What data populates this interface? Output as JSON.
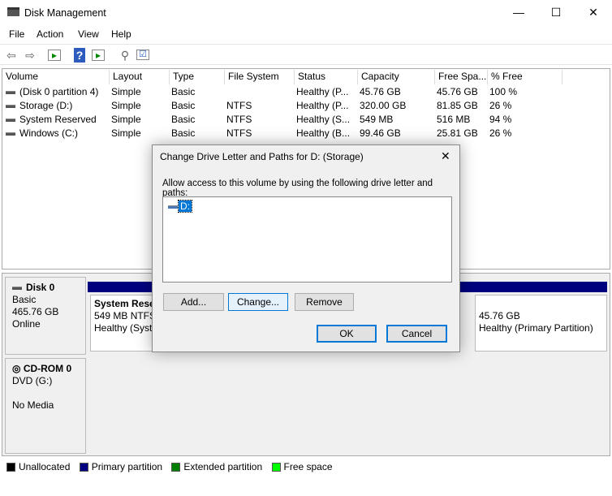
{
  "window": {
    "title": "Disk Management",
    "minimize": "—",
    "maximize": "☐",
    "close": "✕"
  },
  "menu": [
    "File",
    "Action",
    "View",
    "Help"
  ],
  "toolbar": {
    "icons": [
      "back-arrow-icon",
      "forward-arrow-icon",
      "console-tree-icon",
      "help-icon",
      "action-pane-icon",
      "connect-icon",
      "properties-icon"
    ]
  },
  "volume_list": {
    "columns": [
      "Volume",
      "Layout",
      "Type",
      "File System",
      "Status",
      "Capacity",
      "Free Spa...",
      "% Free"
    ],
    "rows": [
      [
        "(Disk 0 partition 4)",
        "Simple",
        "Basic",
        "",
        "Healthy (P...",
        "45.76 GB",
        "45.76 GB",
        "100 %"
      ],
      [
        "Storage (D:)",
        "Simple",
        "Basic",
        "NTFS",
        "Healthy (P...",
        "320.00 GB",
        "81.85 GB",
        "26 %"
      ],
      [
        "System Reserved",
        "Simple",
        "Basic",
        "NTFS",
        "Healthy (S...",
        "549 MB",
        "516 MB",
        "94 %"
      ],
      [
        "Windows (C:)",
        "Simple",
        "Basic",
        "NTFS",
        "Healthy (B...",
        "99.46 GB",
        "25.81 GB",
        "26 %"
      ]
    ]
  },
  "disks": [
    {
      "name": "Disk 0",
      "type": "Basic",
      "size": "465.76 GB",
      "status": "Online",
      "partitions": [
        {
          "name": "System Rese",
          "detail": "549 MB NTFS",
          "status": "Healthy (Syste"
        },
        {
          "name": "",
          "detail": "45.76 GB",
          "status": "Healthy (Primary Partition)"
        }
      ]
    },
    {
      "name": "CD-ROM 0",
      "type": "DVD (G:)",
      "status": "No Media"
    }
  ],
  "legend": [
    {
      "label": "Unallocated",
      "color": "#000000"
    },
    {
      "label": "Primary partition",
      "color": "#00007f"
    },
    {
      "label": "Extended partition",
      "color": "#007f00"
    },
    {
      "label": "Free space",
      "color": "#00ff00"
    }
  ],
  "dialog": {
    "title": "Change Drive Letter and Paths for D: (Storage)",
    "instruction": "Allow access to this volume by using the following drive letter and paths:",
    "paths": [
      "D:"
    ],
    "add": "Add...",
    "change": "Change...",
    "remove": "Remove",
    "ok": "OK",
    "cancel": "Cancel",
    "close": "✕"
  }
}
